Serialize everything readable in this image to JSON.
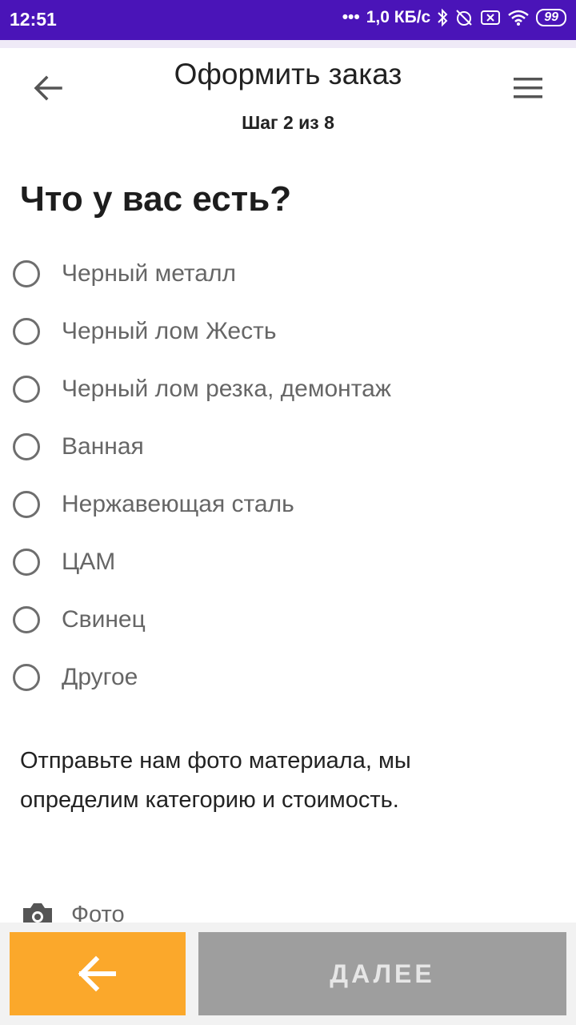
{
  "status_bar": {
    "time": "12:51",
    "network_speed": "1,0 КБ/с",
    "battery": "99",
    "icons": [
      "more-dots-icon",
      "bluetooth-icon",
      "alarm-off-icon",
      "sim-x-icon",
      "wifi-icon",
      "battery-icon"
    ]
  },
  "header": {
    "title": "Оформить заказ",
    "step": "Шаг 2 из 8",
    "back_icon": "arrow-left-icon",
    "menu_icon": "hamburger-menu-icon"
  },
  "question": "Что у вас есть?",
  "options": [
    {
      "label": "Черный металл",
      "selected": false
    },
    {
      "label": "Черный лом Жесть",
      "selected": false
    },
    {
      "label": "Черный лом резка, демонтаж",
      "selected": false
    },
    {
      "label": "Ванная",
      "selected": false
    },
    {
      "label": "Нержавеющая сталь",
      "selected": false
    },
    {
      "label": "ЦАМ",
      "selected": false
    },
    {
      "label": "Свинец",
      "selected": false
    },
    {
      "label": "Другое",
      "selected": false
    }
  ],
  "info": {
    "line1": "Отправьте нам фото материала, мы",
    "line2": "определим категорию и стоимость."
  },
  "photo": {
    "label": "Фото",
    "icon": "camera-icon"
  },
  "buttons": {
    "back_icon": "arrow-left-icon",
    "next_label": "ДАЛЕЕ"
  },
  "colors": {
    "status_bar": "#4a14b8",
    "back_button": "#fba82b",
    "next_button": "#9e9e9e"
  }
}
